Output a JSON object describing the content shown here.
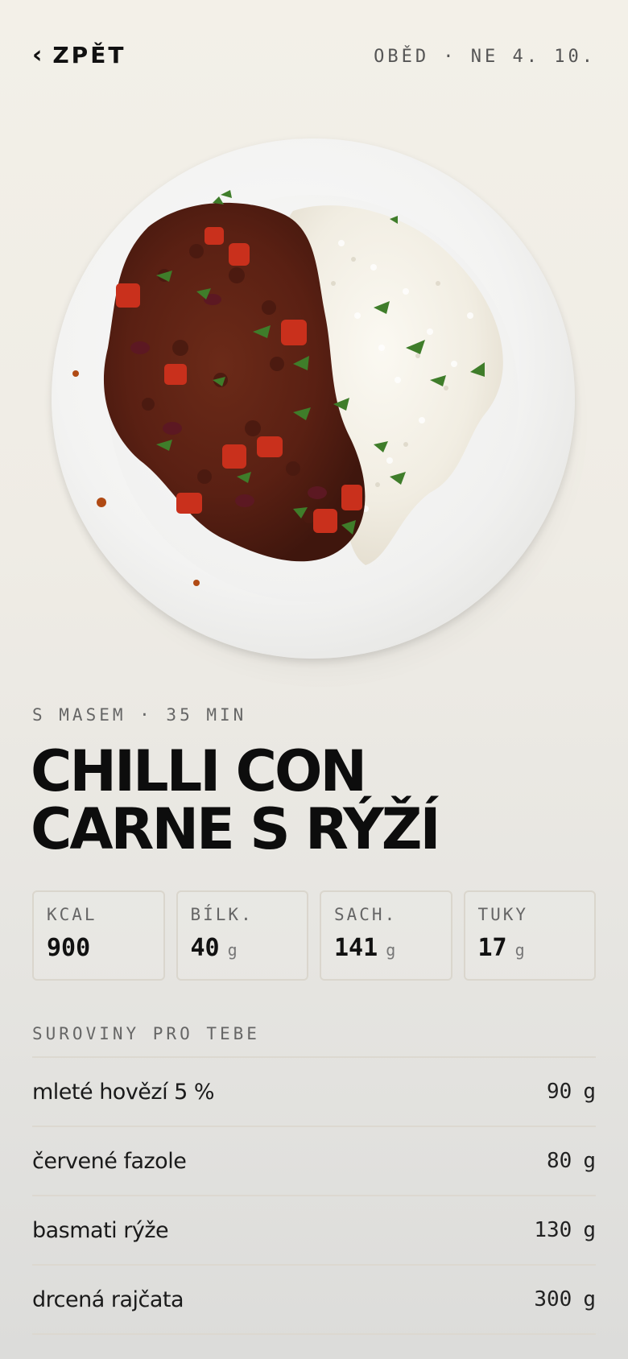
{
  "header": {
    "back_label": "ZPĚT",
    "back_icon": "chevron-left-icon",
    "meal_date": "OBĚD · NE 4. 10."
  },
  "recipe": {
    "tagline": "S MASEM · 35 MIN",
    "title_line1": "CHILLI CON",
    "title_line2": "CARNE S RÝŽÍ"
  },
  "macros": [
    {
      "label": "KCAL",
      "value": "900",
      "unit": ""
    },
    {
      "label": "BÍLK.",
      "value": "40",
      "unit": "g"
    },
    {
      "label": "SACH.",
      "value": "141",
      "unit": "g"
    },
    {
      "label": "TUKY",
      "value": "17",
      "unit": "g"
    }
  ],
  "ingredients_section": {
    "title": "SUROVINY PRO TEBE",
    "items": [
      {
        "name": "mleté hovězí 5 %",
        "amount": "90",
        "unit": "g"
      },
      {
        "name": "červené fazole",
        "amount": "80",
        "unit": "g"
      },
      {
        "name": "basmati rýže",
        "amount": "130",
        "unit": "g"
      },
      {
        "name": "drcená rajčata",
        "amount": "300",
        "unit": "g"
      }
    ]
  },
  "colors": {
    "background": "#f1eee7",
    "text": "#111111",
    "muted": "#666666",
    "border": "#dcd8d0"
  }
}
